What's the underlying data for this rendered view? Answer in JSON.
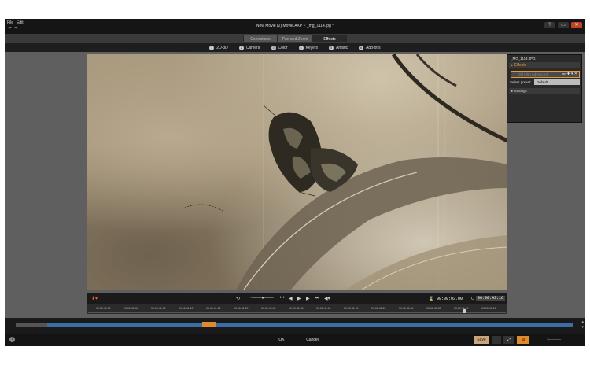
{
  "window": {
    "title": "New Movie (2).Movie.AXP  ~  _mg_1114.jpg  *",
    "menu": [
      "File",
      "Edit"
    ],
    "controls": [
      "⊤",
      "▭",
      "✕"
    ]
  },
  "tabs": [
    {
      "label": "Corrections",
      "active": false
    },
    {
      "label": "Pan and Zoom",
      "active": false
    },
    {
      "label": "Effects",
      "active": true
    }
  ],
  "categories": [
    {
      "num": "1",
      "label": "2D-3D"
    },
    {
      "num": "2",
      "label": "Camera"
    },
    {
      "num": "3",
      "label": "Color"
    },
    {
      "num": "4",
      "label": "Keyers"
    },
    {
      "num": "5",
      "label": "Artistic"
    },
    {
      "num": "6",
      "label": "Add-ons"
    }
  ],
  "panel": {
    "filename": "_MG_1114.JPG",
    "close": "–",
    "effects_label": "Effects",
    "effect_name": "Old Film Advanced",
    "effect_icons": "☰ ✚ ▾ ✕",
    "preset_label": "Select preset:",
    "preset_value": "Default",
    "settings_label": "Settings"
  },
  "transport": {
    "timecode_label": "⌛",
    "timecode": "00:00:03.00",
    "tc_label": "TC",
    "tc_value": "00:00:43.16"
  },
  "ruler_ticks": [
    "00:00:40.30",
    "00:00:41.00",
    "00:00:41.05",
    "00:00:41.10",
    "00:00:41.15",
    "00:00:41.20",
    "00:00:42.00",
    "00:00:42.05",
    "00:00:42.10",
    "00:00:42.15",
    "00:00:42.20",
    "00:00:43.00",
    "00:00:43.05",
    "00:00:43.10",
    "00:00:43.15"
  ],
  "footer": {
    "info": "i",
    "ok": "OK",
    "cancel": "Cancel",
    "tools": [
      "Save",
      "◐",
      "⤢",
      "▤",
      "○———"
    ]
  },
  "colors": {
    "accent": "#e89a3c",
    "scrub": "#3a6ea5",
    "close": "#c0422a"
  }
}
